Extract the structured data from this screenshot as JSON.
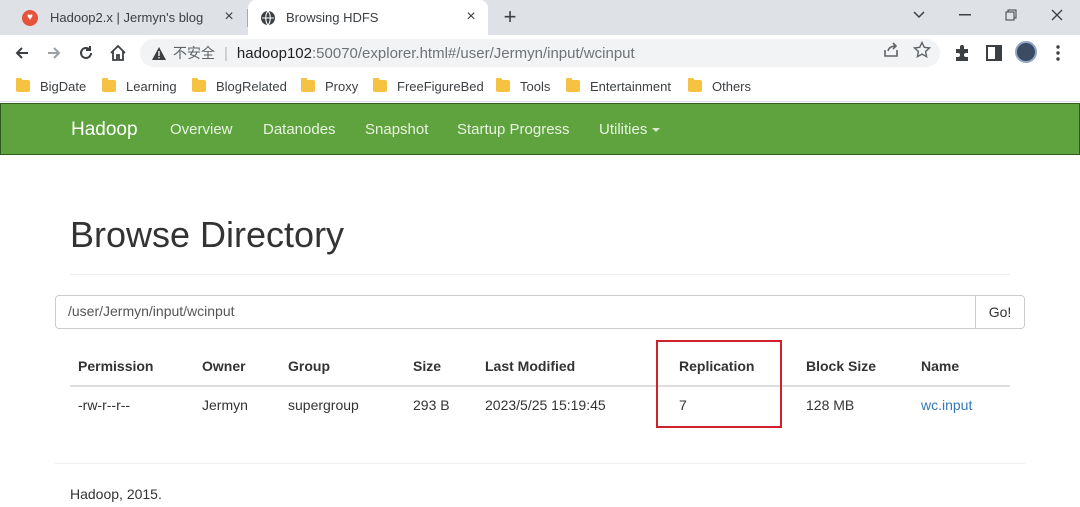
{
  "browser": {
    "tabs": [
      {
        "title": "Hadoop2.x | Jermyn's blog"
      },
      {
        "title": "Browsing HDFS"
      }
    ],
    "address": {
      "insecure_label": "不安全",
      "host": "hadoop102",
      "rest": ":50070/explorer.html#/user/Jermyn/input/wcinput"
    },
    "bookmarks": [
      "BigDate",
      "Learning",
      "BlogRelated",
      "Proxy",
      "FreeFigureBed",
      "Tools",
      "Entertainment",
      "Others"
    ]
  },
  "navbar": {
    "brand": "Hadoop",
    "links": [
      "Overview",
      "Datanodes",
      "Snapshot",
      "Startup Progress",
      "Utilities"
    ]
  },
  "page": {
    "title": "Browse Directory",
    "path_value": "/user/Jermyn/input/wcinput",
    "go_label": "Go!",
    "columns": [
      "Permission",
      "Owner",
      "Group",
      "Size",
      "Last Modified",
      "Replication",
      "Block Size",
      "Name"
    ],
    "rows": [
      [
        "-rw-r--r--",
        "Jermyn",
        "supergroup",
        "293 B",
        "2023/5/25 15:19:45",
        "7",
        "128 MB",
        "wc.input"
      ]
    ],
    "footer": "Hadoop, 2015."
  },
  "colors": {
    "navbar_green": "#5fa33e",
    "link_blue": "#337ab7",
    "highlight_red": "#d0202a"
  }
}
